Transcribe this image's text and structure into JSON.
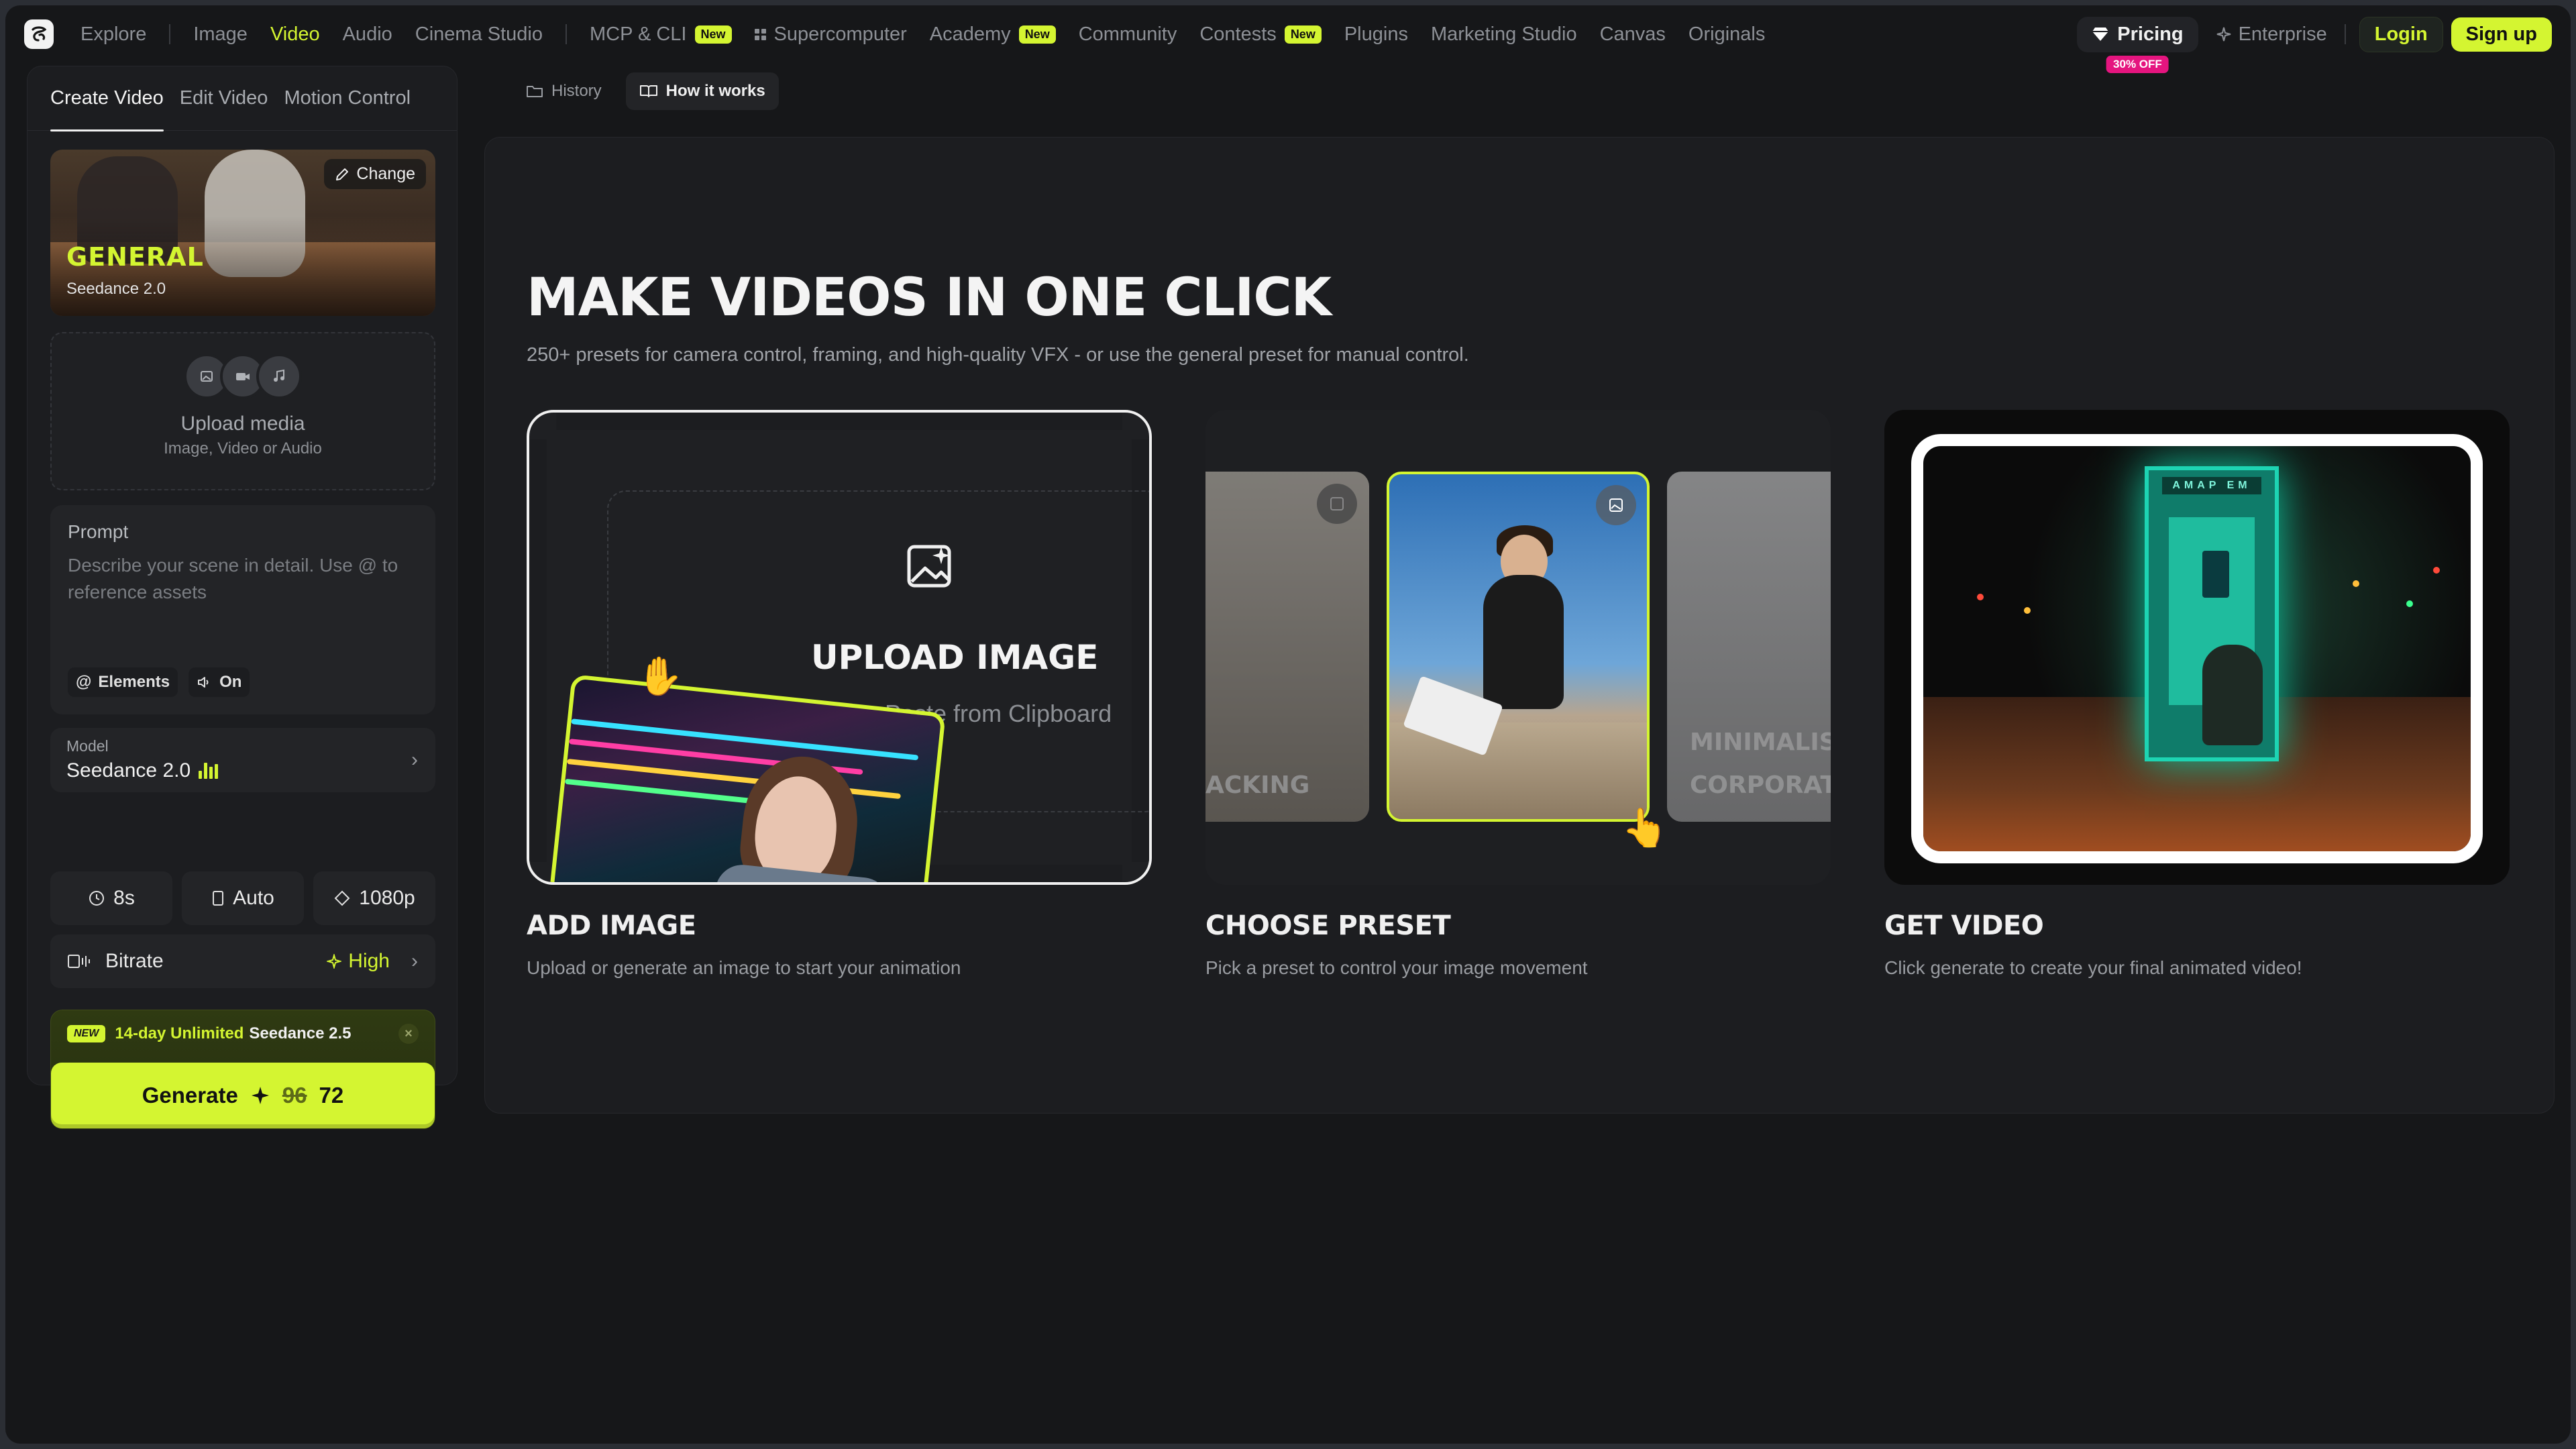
{
  "nav": {
    "items": [
      {
        "label": "Explore",
        "active": false,
        "badge": ""
      },
      {
        "label": "Image",
        "active": false,
        "badge": ""
      },
      {
        "label": "Video",
        "active": true,
        "badge": ""
      },
      {
        "label": "Audio",
        "active": false,
        "badge": ""
      },
      {
        "label": "Cinema Studio",
        "active": false,
        "badge": ""
      },
      {
        "label": "MCP & CLI",
        "active": false,
        "badge": "New"
      },
      {
        "label": "Supercomputer",
        "active": false,
        "badge": ""
      },
      {
        "label": "Academy",
        "active": false,
        "badge": "New"
      },
      {
        "label": "Community",
        "active": false,
        "badge": ""
      },
      {
        "label": "Contests",
        "active": false,
        "badge": "New"
      },
      {
        "label": "Plugins",
        "active": false,
        "badge": ""
      },
      {
        "label": "Marketing Studio",
        "active": false,
        "badge": ""
      },
      {
        "label": "Canvas",
        "active": false,
        "badge": ""
      },
      {
        "label": "Originals",
        "active": false,
        "badge": ""
      }
    ],
    "pricing": "Pricing",
    "pricing_badge": "30% OFF",
    "enterprise": "Enterprise",
    "login": "Login",
    "signup": "Sign up"
  },
  "sidebar": {
    "tabs": [
      "Create Video",
      "Edit Video",
      "Motion Control"
    ],
    "active_tab": 0,
    "preset": {
      "change_label": "Change",
      "title": "GENERAL",
      "model": "Seedance 2.0"
    },
    "upload": {
      "title": "Upload media",
      "subtitle": "Image, Video or Audio"
    },
    "prompt": {
      "label": "Prompt",
      "placeholder": "Describe your scene in detail. Use @ to reference assets",
      "elements_label": "Elements",
      "audio_label": "On"
    },
    "model": {
      "label": "Model",
      "value": "Seedance 2.0"
    },
    "options": {
      "duration": "8s",
      "aspect": "Auto",
      "resolution": "1080p"
    },
    "bitrate": {
      "label": "Bitrate",
      "value": "High"
    },
    "promo": {
      "badge": "NEW",
      "text_highlight": "14-day Unlimited",
      "text_model": "Seedance 2.5"
    },
    "generate": {
      "label": "Generate",
      "old_cost": "96",
      "cost": "72"
    }
  },
  "main": {
    "tabs": [
      {
        "label": "History",
        "icon": "folder-icon",
        "active": false
      },
      {
        "label": "How it works",
        "icon": "book-icon",
        "active": true
      }
    ],
    "title": "MAKE VIDEOS IN ONE CLICK",
    "subtitle": "250+ presets for camera control, framing, and high-quality VFX - or use the general preset for manual control.",
    "steps": [
      {
        "title": "ADD IMAGE",
        "description": "Upload or generate an image to start your animation",
        "card_title": "UPLOAD IMAGE",
        "card_sub": "Paste from Clipboard"
      },
      {
        "title": "CHOOSE PRESET",
        "description": "Pick a preset to control your image movement",
        "left_label": "ACKING",
        "right_label_1": "MINIMALISM",
        "right_label_2": "CORPORATE"
      },
      {
        "title": "GET VIDEO",
        "description": "Click generate to create your final animated video!",
        "booth_sign": "AMAP EM"
      }
    ]
  },
  "colors": {
    "accent": "#d4f531",
    "background": "#161719",
    "panel": "#1c1d20",
    "pink_badge": "#e5157f"
  }
}
